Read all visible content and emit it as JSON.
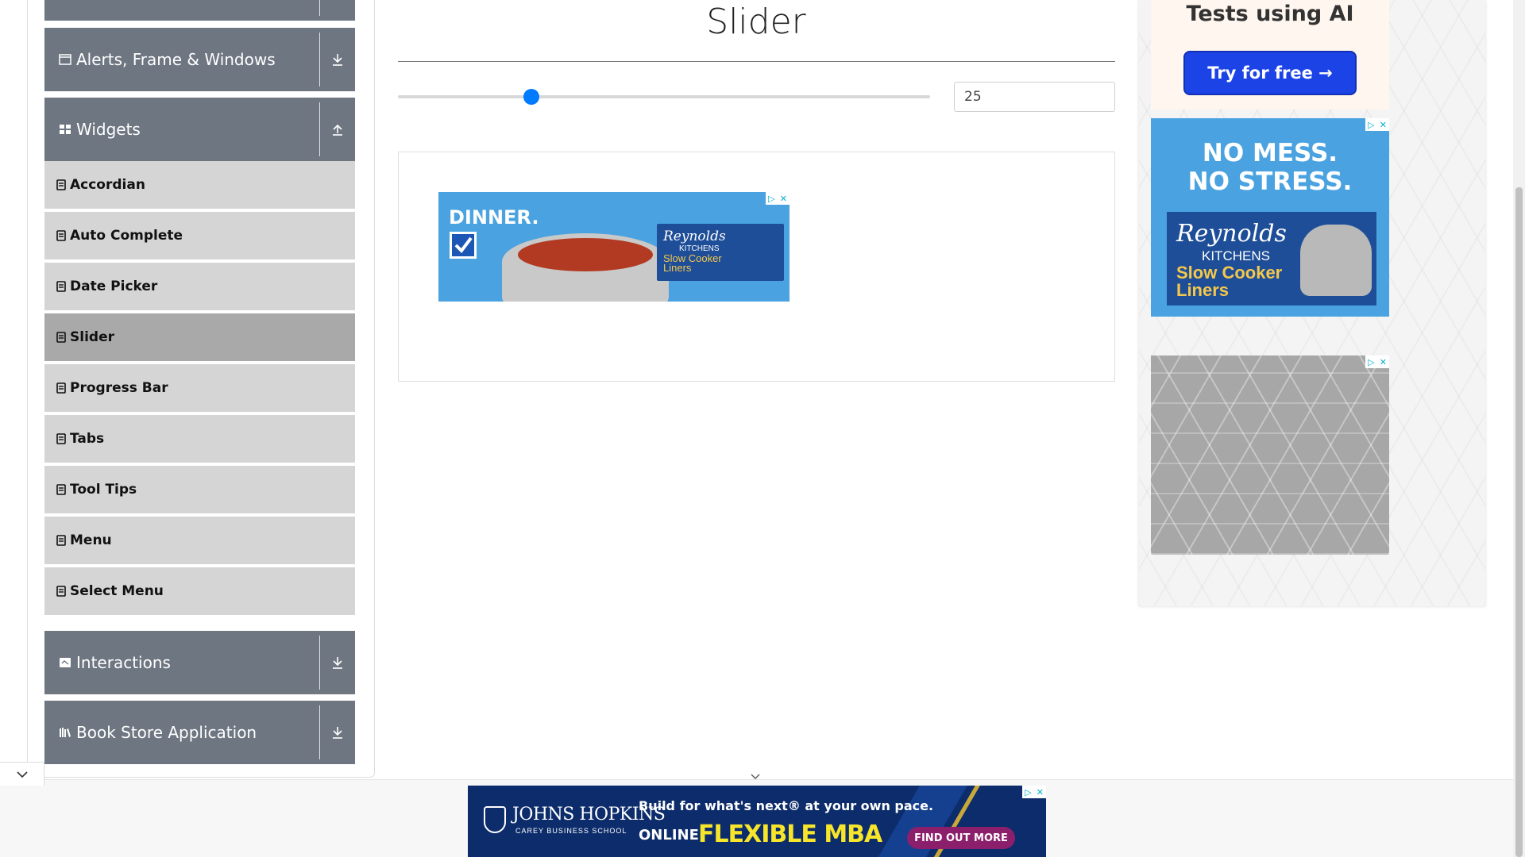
{
  "sidebar": {
    "groups": {
      "alerts": {
        "label": "Alerts, Frame & Windows"
      },
      "widgets": {
        "label": "Widgets"
      },
      "interactions": {
        "label": "Interactions"
      },
      "bookstore": {
        "label": "Book Store Application"
      }
    },
    "widget_items": [
      {
        "label": "Accordian"
      },
      {
        "label": "Auto Complete"
      },
      {
        "label": "Date Picker"
      },
      {
        "label": "Slider"
      },
      {
        "label": "Progress Bar"
      },
      {
        "label": "Tabs"
      },
      {
        "label": "Tool Tips"
      },
      {
        "label": "Menu"
      },
      {
        "label": "Select Menu"
      }
    ],
    "active_item": "Slider"
  },
  "main": {
    "title": "Slider",
    "slider": {
      "value": 25,
      "value_text": "25",
      "min": 0,
      "max": 100
    },
    "accent_color": "#007bff"
  },
  "ads": {
    "dinner": {
      "headline": "DINNER.",
      "brand": "Reynolds",
      "brand_sub": "KITCHENS",
      "product": "Slow Cooker Liners"
    },
    "ai": {
      "text": "Tests using AI",
      "button": "Try for free →"
    },
    "reynolds": {
      "line1": "NO MESS.",
      "line2": "NO STRESS.",
      "brand": "Reynolds",
      "brand_sub": "KITCHENS",
      "product": "Slow Cooker Liners"
    },
    "jhu": {
      "name": "JOHNS HOPKINS",
      "sub": "CAREY BUSINESS SCHOOL",
      "headline": "Build for what's next® at your own pace.",
      "online": "ONLINE",
      "program": "FLEXIBLE MBA",
      "cta": "FIND OUT MORE"
    }
  },
  "icons": {
    "window": "window-icon",
    "grid": "grid-icon",
    "book": "book-icon",
    "download": "download-arrow-icon",
    "upload": "upload-arrow-icon",
    "chevron": "chevron-down-icon"
  }
}
